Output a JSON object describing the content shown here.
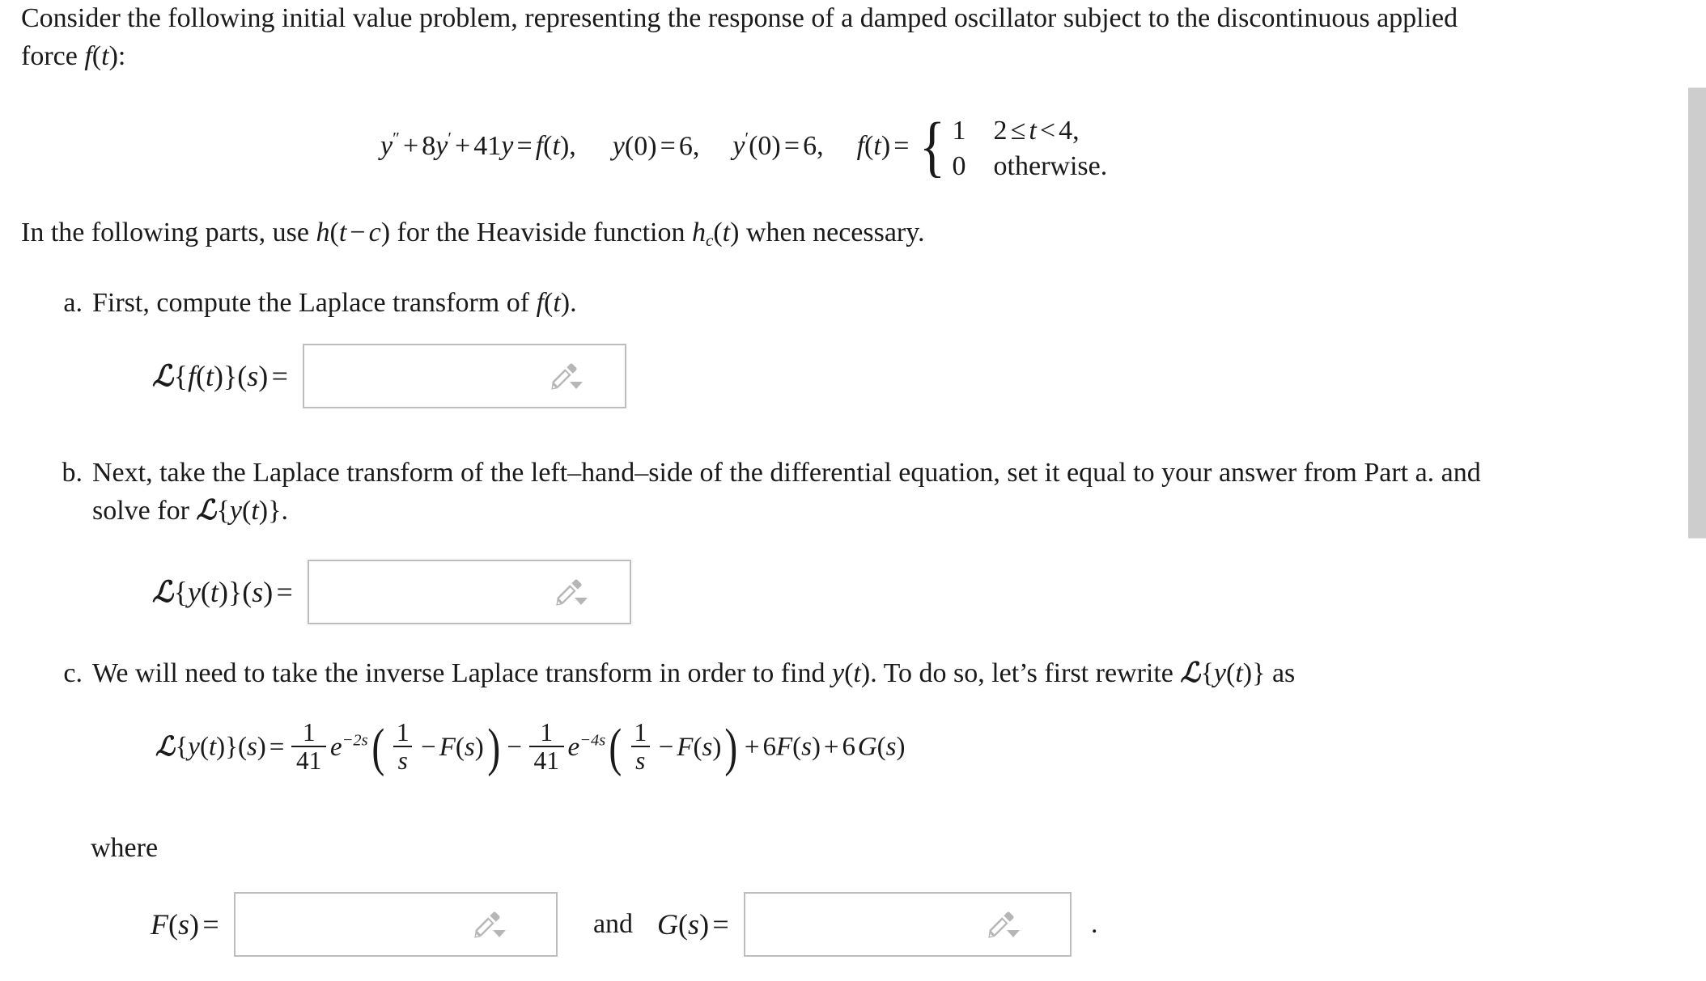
{
  "document": {
    "intro": {
      "line1": "Consider the following initial value problem, representing the response of a damped oscillator subject to the discontinuous applied",
      "line2_prefix": "force ",
      "line2_math": "f(t)",
      "line2_suffix": ":"
    },
    "main_equation": {
      "ode_lhs": "y'' + 8y' + 41y = f(t),",
      "initial_condition_1": "y(0) = 6,",
      "initial_condition_2": "y'(0) = 6,",
      "forcing_label": "f(t) =",
      "case_1_value": "1",
      "case_1_condition": "2 ≤ t < 4,",
      "case_2_value": "0",
      "case_2_condition": "otherwise.",
      "coefficient_damping": "8",
      "coefficient_stiffness": "41",
      "y0": "6",
      "yprime0": "6",
      "t_lower": "2",
      "t_upper": "4"
    },
    "heaviside_note": {
      "text_before": "In the following parts, use ",
      "math_1": "h(t − c)",
      "text_middle": " for the Heaviside function ",
      "math_2": "h_c(t)",
      "text_after": " when necessary."
    },
    "parts": [
      {
        "marker": "a.",
        "text_before": "First, compute the Laplace transform of ",
        "math": "f(t)",
        "text_after": "."
      },
      {
        "marker": "b.",
        "line1": "Next, take the Laplace transform of the left–hand–side of the differential equation, set it equal to your answer from Part a. and",
        "line2_before": "solve for ",
        "line2_math": "ℒ{y(t)}",
        "line2_after": "."
      },
      {
        "marker": "c.",
        "text_before": "We will need to take the inverse Laplace transform in order to find ",
        "math_1": "y(t)",
        "text_middle": ". To do so, let’s first rewrite ",
        "math_2": "ℒ{y(t)}",
        "text_after": " as"
      }
    ],
    "part_c_equation": {
      "lhs": "ℒ{y(t)}(s) =",
      "coefficient": "41",
      "exponent_1": "−2s",
      "exponent_2": "−4s",
      "inner_fraction": "1/s",
      "term_F": "F(s)",
      "constant_F": "6",
      "constant_G": "6",
      "term_G": "G(s)",
      "full": "ℒ{y(t)}(s) = (1/41)e^{-2s}(1/s − F(s)) − (1/41)e^{-4s}(1/s − F(s)) + 6F(s) + 6G(s)"
    },
    "where_label": "where",
    "answers": [
      {
        "id": "laplace-f",
        "label": "ℒ{f(t)}(s) =",
        "value": "",
        "placeholder": ""
      },
      {
        "id": "laplace-y",
        "label": "ℒ{y(t)}(s) =",
        "value": "",
        "placeholder": ""
      },
      {
        "id": "F-of-s",
        "label": "F(s) =",
        "value": "",
        "placeholder": ""
      },
      {
        "id": "G-of-s",
        "label": "G(s) =",
        "value": "",
        "placeholder": ""
      }
    ],
    "conjunction": "and",
    "trailing_period": ".",
    "icons": {
      "math_editor": "pencil-icon",
      "math_editor_menu": "caret-down-icon"
    },
    "colors": {
      "text": "#1a1a1a",
      "input_border": "#bdbdbd",
      "icon_gray": "#b3b3b3",
      "scrollbar_thumb": "#cdcdcd",
      "background": "#ffffff"
    }
  }
}
